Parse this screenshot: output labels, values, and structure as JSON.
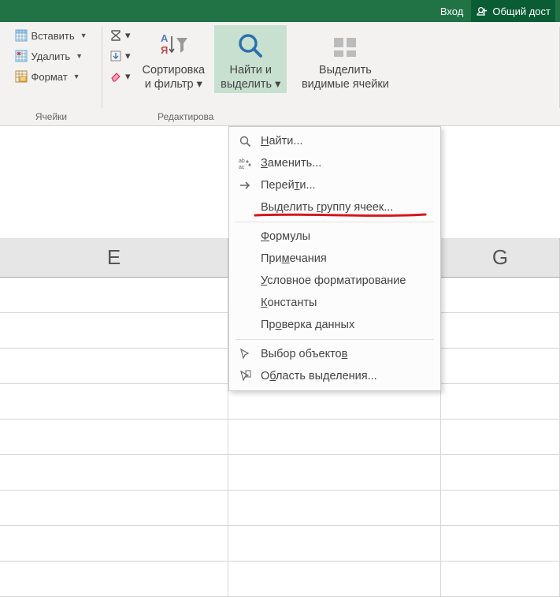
{
  "titlebar": {
    "login": "Вход",
    "share": "Общий дост"
  },
  "ribbon": {
    "cells": {
      "insert": "Вставить",
      "delete": "Удалить",
      "format": "Формат",
      "group_label": "Ячейки"
    },
    "editing": {
      "sort_filter_l1": "Сортировка",
      "sort_filter_l2": "и фильтр",
      "find_select_l1": "Найти и",
      "find_select_l2": "выделить",
      "select_visible_l1": "Выделить",
      "select_visible_l2": "видимые ячейки",
      "group_label": "Редактирова"
    }
  },
  "menu": {
    "find": "Найти...",
    "replace": "Заменить...",
    "goto": "Перейти...",
    "goto_special": "Выделить группу ячеек...",
    "formulas": "Формулы",
    "comments": "Примечания",
    "cond_fmt": "Условное форматирование",
    "constants": "Константы",
    "data_validation": "Проверка данных",
    "select_objects": "Выбор объектов",
    "selection_pane": "Область выделения..."
  },
  "columns": {
    "e": "E",
    "g": "G"
  }
}
